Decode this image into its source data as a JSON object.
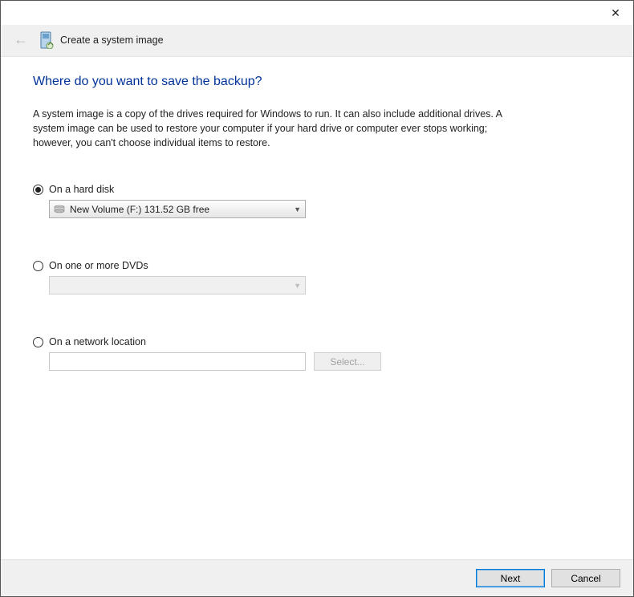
{
  "titlebar": {
    "close": "✕"
  },
  "header": {
    "title": "Create a system image"
  },
  "main": {
    "heading": "Where do you want to save the backup?",
    "description": "A system image is a copy of the drives required for Windows to run. It can also include additional drives. A system image can be used to restore your computer if your hard drive or computer ever stops working; however, you can't choose individual items to restore.",
    "option_hard_disk": {
      "label": "On a hard disk",
      "selected_drive": "New Volume (F:)  131.52 GB free"
    },
    "option_dvd": {
      "label": "On one or more DVDs"
    },
    "option_network": {
      "label": "On a network location",
      "select_button": "Select..."
    }
  },
  "footer": {
    "next": "Next",
    "cancel": "Cancel"
  }
}
